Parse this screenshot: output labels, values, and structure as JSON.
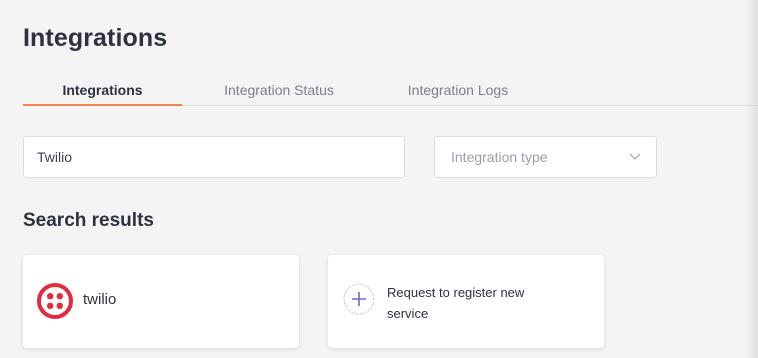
{
  "page": {
    "title": "Integrations"
  },
  "tabs": [
    {
      "label": "Integrations",
      "active": true
    },
    {
      "label": "Integration Status",
      "active": false
    },
    {
      "label": "Integration Logs",
      "active": false
    }
  ],
  "filters": {
    "search_value": "Twilio",
    "type_select": {
      "placeholder": "Integration type",
      "icon": "chevron-down-icon"
    }
  },
  "results": {
    "title": "Search results",
    "cards": [
      {
        "name": "twilio",
        "icon": "twilio-logo-icon"
      },
      {
        "name": "Request to register new service",
        "icon": "plus-icon"
      }
    ]
  },
  "colors": {
    "accent": "#f0834f",
    "twilio_red": "#e22c3d",
    "plus_purple": "#7b63c6",
    "background": "#f4f4f4"
  }
}
